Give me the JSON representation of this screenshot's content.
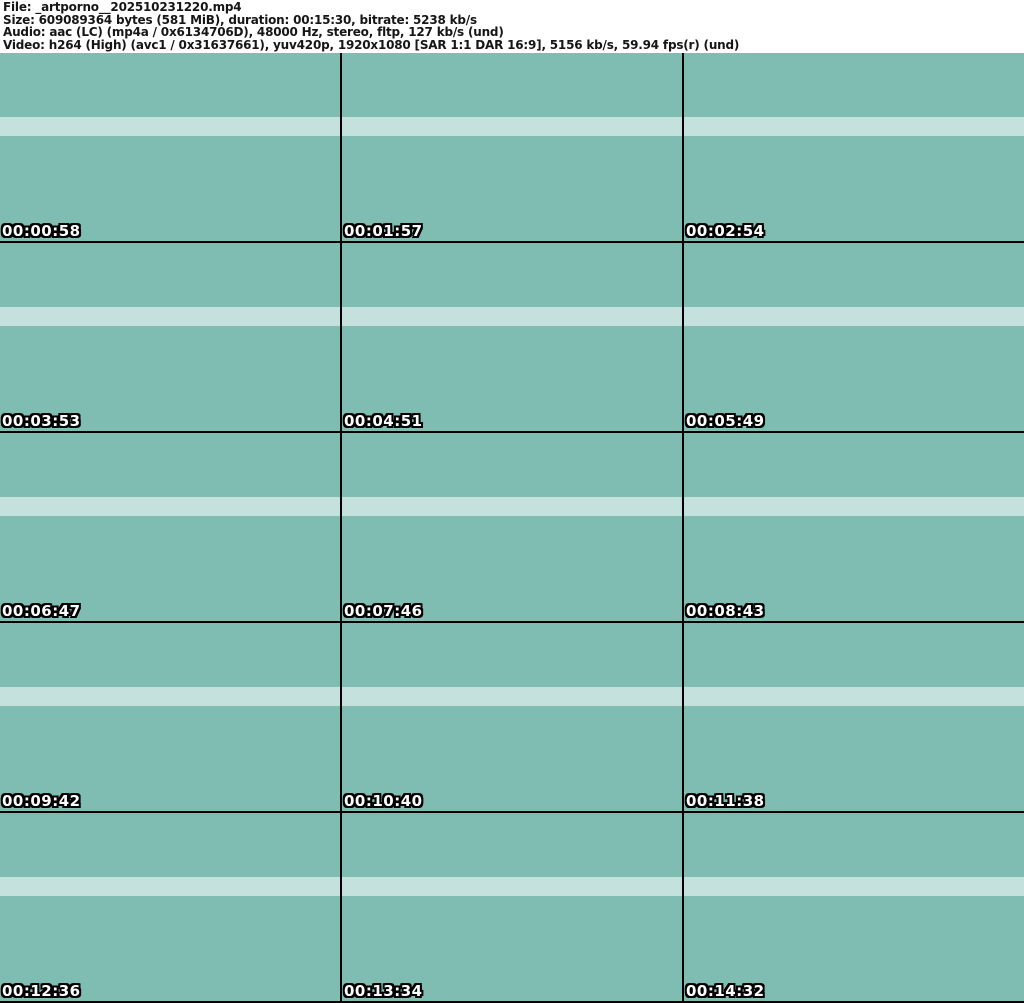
{
  "header": {
    "lines": [
      "File: _artporno__202510231220.mp4",
      "Size: 609089364 bytes (581 MiB), duration: 00:15:30, bitrate: 5238 kb/s",
      "Audio: aac (LC) (mp4a / 0x6134706D), 48000 Hz, stereo, fltp, 127 kb/s (und)",
      "Video: h264 (High) (avc1 / 0x31637661), yuv420p, 1920x1080 [SAR 1:1 DAR 16:9], 5156 kb/s, 59.94 fps(r) (und)"
    ]
  },
  "grid": {
    "columns": 3,
    "rows": 5,
    "thumbnails": [
      {
        "timestamp": "00:00:58"
      },
      {
        "timestamp": "00:01:57"
      },
      {
        "timestamp": "00:02:54"
      },
      {
        "timestamp": "00:03:53"
      },
      {
        "timestamp": "00:04:51"
      },
      {
        "timestamp": "00:05:49"
      },
      {
        "timestamp": "00:06:47"
      },
      {
        "timestamp": "00:07:46"
      },
      {
        "timestamp": "00:08:43"
      },
      {
        "timestamp": "00:09:42"
      },
      {
        "timestamp": "00:10:40"
      },
      {
        "timestamp": "00:11:38"
      },
      {
        "timestamp": "00:12:36"
      },
      {
        "timestamp": "00:13:34"
      },
      {
        "timestamp": "00:14:32"
      }
    ]
  },
  "colors": {
    "header_bg": "#ffffff",
    "header_text": "#161616",
    "grid_gap": "#000000",
    "scene_teal": "#69bdb1",
    "scene_light": "#e3ece8",
    "timestamp_text": "#ffffff",
    "timestamp_outline": "#000000"
  }
}
